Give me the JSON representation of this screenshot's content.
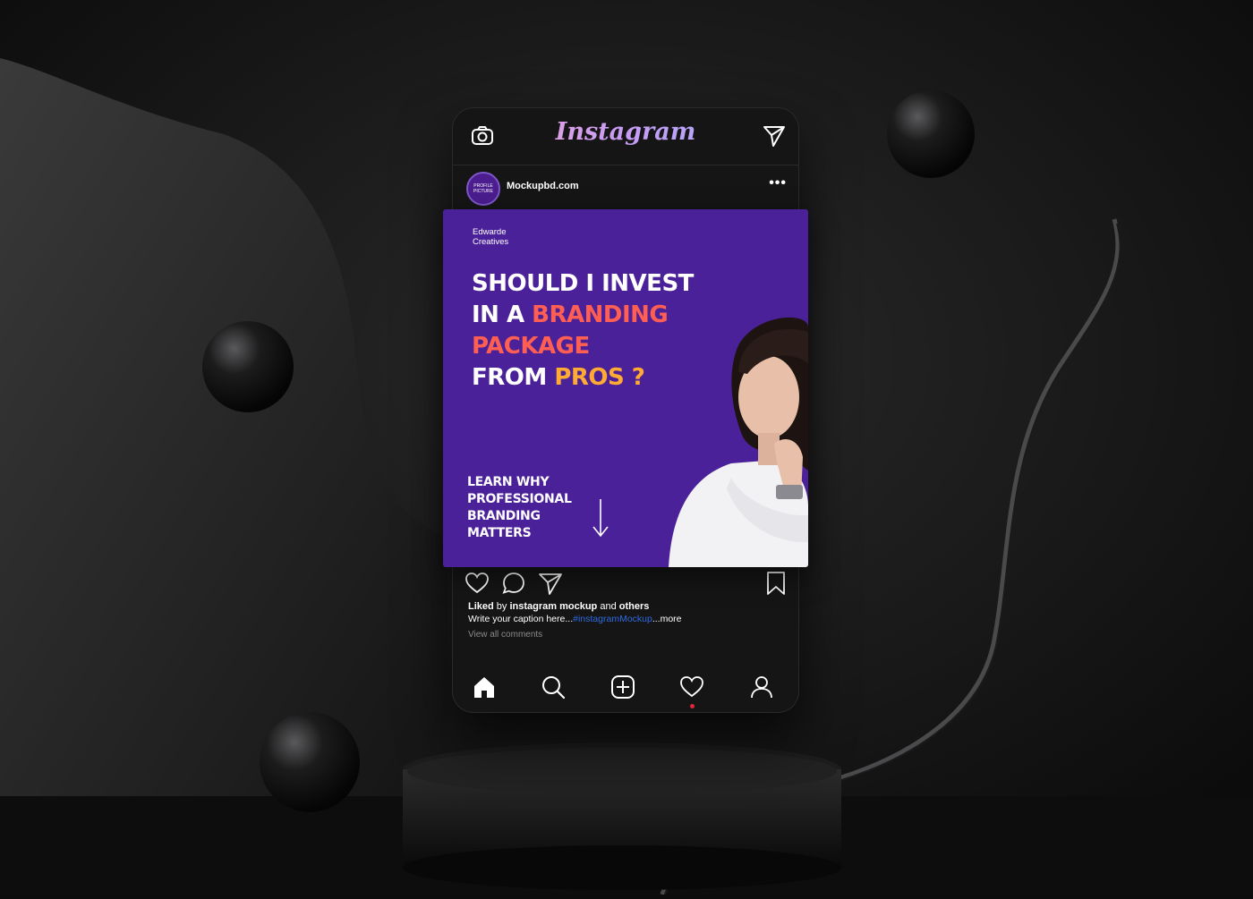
{
  "app": {
    "title": "Instagram"
  },
  "post": {
    "username": "Mockupbd.com",
    "avatar_text": [
      "PROFILE",
      "PICTURE"
    ],
    "more_label": "•••",
    "brand_lines": [
      "Edwarde",
      "Creatives"
    ],
    "headline": {
      "l1": "SHOULD I INVEST",
      "l2a": "IN A ",
      "l2b": "BRANDING",
      "l3": "PACKAGE",
      "l4a": "FROM ",
      "l4b": "PROS ?"
    },
    "learn_lines": [
      "LEARN WHY",
      "PROFESSIONAL",
      "BRANDING",
      "MATTERS"
    ],
    "liked": {
      "prefix": "Liked",
      "by": " by ",
      "user": "instagram mockup",
      "and": " and ",
      "others": "others"
    },
    "caption": {
      "text": "Write your caption here...",
      "tag": "#instagramMockup",
      "more": "...more"
    },
    "view_all": "View all comments"
  },
  "icons": {
    "top_left": "camera-icon",
    "top_right": "send-icon",
    "actions": [
      "heart-icon",
      "comment-icon",
      "share-icon",
      "bookmark-icon"
    ],
    "nav": [
      "home-icon",
      "search-icon",
      "add-icon",
      "activity-icon",
      "profile-icon"
    ]
  },
  "colors": {
    "accent_red": "#ff5f52",
    "accent_orange": "#ffaa33",
    "post_bg": "#4b2199",
    "link": "#2f6be0",
    "notify": "#e0263a"
  }
}
